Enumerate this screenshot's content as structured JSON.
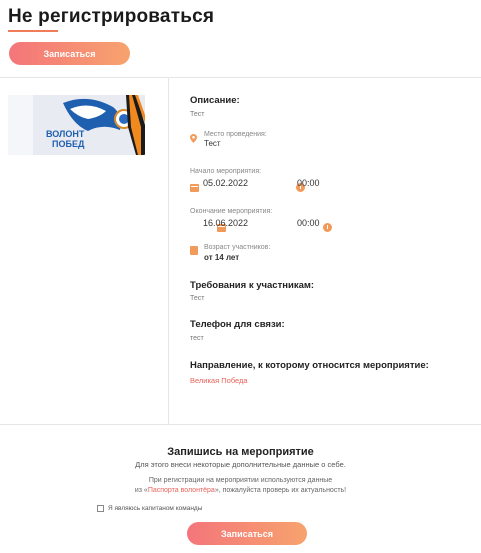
{
  "header": {
    "title": "Не регистрироваться",
    "register_label": "Записаться"
  },
  "image": {
    "logo_text_line1": "ВОЛОНТ",
    "logo_text_line2": "ПОБЕД"
  },
  "details": {
    "description_label": "Описание:",
    "description_value": "Тест",
    "location_label": "Место проведения:",
    "location_value": "Тест",
    "start_label": "Начало мероприятия:",
    "start_date": "05.02.2022",
    "start_time": "00:00",
    "end_label": "Окончание мероприятия:",
    "end_date": "16.06.2022",
    "end_time": "00:00",
    "age_label": "Возраст участников:",
    "age_value": "от 14 лет",
    "requirements_label": "Требования к участникам:",
    "requirements_value": "Тест",
    "phone_label": "Телефон для связи:",
    "phone_value": "тест",
    "direction_label": "Направление, к которому относится мероприятие:",
    "direction_value": "Великая Победа"
  },
  "signup": {
    "title": "Запишись на мероприятие",
    "subtitle": "Для этого внеси некоторые дополнительные данные о себе.",
    "note_line1": "При регистрации на мероприятии используются данные",
    "note_prefix": "из «",
    "note_link": "Паспорта волонтёра",
    "note_suffix": "», пожалуйста проверь их актуальность!",
    "captain_label": "Я являюсь капитаном команды",
    "register_label": "Записаться"
  },
  "colors": {
    "accent_start": "#f4757a",
    "accent_end": "#f7a36e",
    "link": "#e8625a",
    "icon": "#f29a5a"
  }
}
